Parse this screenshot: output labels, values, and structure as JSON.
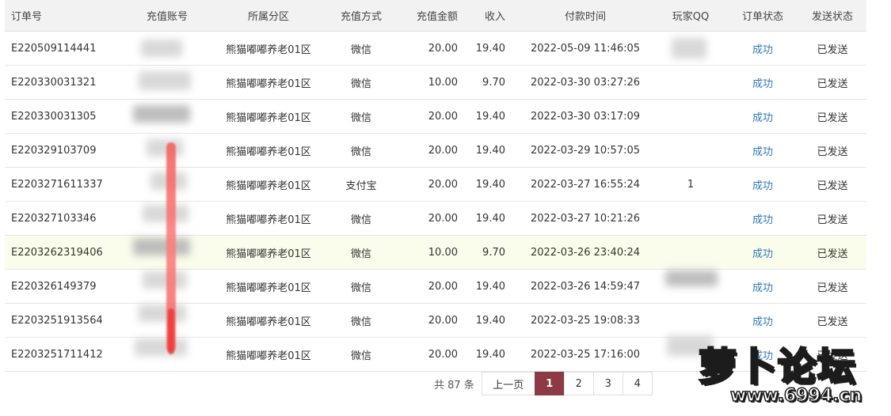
{
  "table": {
    "headers": {
      "order": "订单号",
      "account": "充值账号",
      "zone": "所属分区",
      "method": "充值方式",
      "amount": "充值金额",
      "income": "收入",
      "time": "付款时间",
      "qq": "玩家QQ",
      "status": "订单状态",
      "send": "发送状态"
    },
    "rows": [
      {
        "order": "E220509114441",
        "zone": "熊猫嘟嘟养老01区",
        "method": "微信",
        "amount": "20.00",
        "income": "19.40",
        "time": "2022-05-09 11:46:05",
        "qq": "",
        "status": "成功",
        "send": "已发送"
      },
      {
        "order": "E220330031321",
        "zone": "熊猫嘟嘟养老01区",
        "method": "微信",
        "amount": "10.00",
        "income": "9.70",
        "time": "2022-03-30 03:27:26",
        "qq": "",
        "status": "成功",
        "send": "已发送"
      },
      {
        "order": "E220330031305",
        "zone": "熊猫嘟嘟养老01区",
        "method": "微信",
        "amount": "20.00",
        "income": "19.40",
        "time": "2022-03-30 03:17:09",
        "qq": "",
        "status": "成功",
        "send": "已发送"
      },
      {
        "order": "E220329103709",
        "zone": "熊猫嘟嘟养老01区",
        "method": "微信",
        "amount": "20.00",
        "income": "19.40",
        "time": "2022-03-29 10:57:05",
        "qq": "",
        "status": "成功",
        "send": "已发送"
      },
      {
        "order": "E2203271611337",
        "zone": "熊猫嘟嘟养老01区",
        "method": "支付宝",
        "amount": "20.00",
        "income": "19.40",
        "time": "2022-03-27 16:55:24",
        "qq": "1",
        "status": "成功",
        "send": "已发送"
      },
      {
        "order": "E220327103346",
        "zone": "熊猫嘟嘟养老01区",
        "method": "微信",
        "amount": "20.00",
        "income": "19.40",
        "time": "2022-03-27 10:21:26",
        "qq": "",
        "status": "成功",
        "send": "已发送"
      },
      {
        "order": "E2203262319406",
        "zone": "熊猫嘟嘟养老01区",
        "method": "微信",
        "amount": "10.00",
        "income": "9.70",
        "time": "2022-03-26 23:40:24",
        "qq": "",
        "status": "成功",
        "send": "已发送"
      },
      {
        "order": "E220326149379",
        "zone": "熊猫嘟嘟养老01区",
        "method": "微信",
        "amount": "20.00",
        "income": "19.40",
        "time": "2022-03-26 14:59:47",
        "qq": "",
        "status": "成功",
        "send": "已发送"
      },
      {
        "order": "E2203251913564",
        "zone": "熊猫嘟嘟养老01区",
        "method": "微信",
        "amount": "20.00",
        "income": "19.40",
        "time": "2022-03-25 19:08:33",
        "qq": "",
        "status": "成功",
        "send": "已发送"
      },
      {
        "order": "E2203251711412",
        "zone": "熊猫嘟嘟养老01区",
        "method": "微信",
        "amount": "20.00",
        "income": "19.40",
        "time": "2022-03-25 17:16:00",
        "qq": "",
        "status": "成功",
        "send": "已发送"
      }
    ],
    "highlight_row": 7
  },
  "pagination": {
    "total_text": "共 87 条",
    "prev_label": "上一页",
    "pages": [
      "1",
      "2",
      "3",
      "4"
    ],
    "active_page": "1"
  },
  "watermark": {
    "title": "萝卜论坛",
    "url": "www.6994.cn"
  },
  "colors": {
    "status_link": "#2f78b8",
    "active_page": "#8d3a45",
    "highlight_row": "#fbfdec"
  }
}
